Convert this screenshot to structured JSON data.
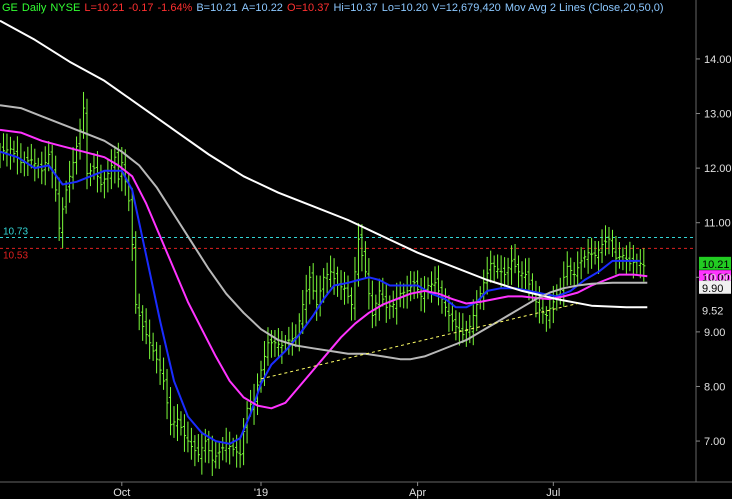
{
  "header": {
    "symbol": "GE",
    "period": "Daily",
    "exchange": "NYSE",
    "last": "L=10.21",
    "change": "-0.17",
    "change_pct": "-1.64%",
    "bid": "B=10.21",
    "ask": "A=10.22",
    "open": "O=10.37",
    "high": "Hi=10.37",
    "low": "Lo=10.20",
    "volume": "V=12,679,420",
    "study": "Mov Avg 2 Lines (Close,20,50,0)"
  },
  "colors": {
    "background": "#000000",
    "bars": "#7CFC3A",
    "ma20": "#1a2cff",
    "ma50": "#ff33ff",
    "ma200": "#ffffff",
    "ma_gray": "#b8b8b8",
    "trendline": "#ffff66",
    "level_cyan": "#33d6d6",
    "level_red": "#e02020",
    "header_green": "#33ff33",
    "header_red": "#ff3030",
    "header_blue": "#8cc8ff",
    "axis_text": "#e0e0e0"
  },
  "chart_data": {
    "type": "line",
    "title": "GE - Daily NYSE",
    "x_labels": [
      "Oct",
      "'19",
      "Apr",
      "Jul"
    ],
    "y_ticks": [
      "14.00",
      "13.00",
      "12.00",
      "11.00",
      "10.00",
      "9.00",
      "8.00",
      "7.00"
    ],
    "ylim": [
      6.25,
      14.75
    ],
    "xlim": [
      0,
      200
    ],
    "x_label_positions": [
      35,
      75,
      120,
      159
    ],
    "price_markers": [
      {
        "label": "10.21",
        "value": 10.21,
        "style": "badge-green"
      },
      {
        "label": "10.00",
        "value": 10.02,
        "style": "badge-magenta"
      },
      {
        "label": "9.90",
        "value": 9.9,
        "style": "badge-white"
      },
      {
        "label": "9.52",
        "value": 9.52,
        "style": "plain"
      }
    ],
    "levels": [
      {
        "label": "10.73",
        "value": 10.73,
        "color": "cyan"
      },
      {
        "label": "10.53",
        "value": 10.53,
        "color": "red"
      }
    ],
    "trendline": [
      [
        75,
        8.14
      ],
      [
        166,
        9.52
      ]
    ],
    "price_close": [
      [
        0,
        12.3
      ],
      [
        3,
        12.35
      ],
      [
        6,
        12.1
      ],
      [
        9,
        12.15
      ],
      [
        12,
        11.95
      ],
      [
        14,
        12.25
      ],
      [
        16,
        11.6
      ],
      [
        17,
        10.9
      ],
      [
        19,
        11.6
      ],
      [
        21,
        12.1
      ],
      [
        23,
        12.7
      ],
      [
        24,
        13.1
      ],
      [
        25,
        11.9
      ],
      [
        27,
        12.0
      ],
      [
        29,
        11.7
      ],
      [
        31,
        11.9
      ],
      [
        33,
        12.2
      ],
      [
        34,
        11.8
      ],
      [
        35,
        12.1
      ],
      [
        37,
        11.4
      ],
      [
        38,
        10.6
      ],
      [
        39,
        9.5
      ],
      [
        41,
        9.1
      ],
      [
        43,
        8.8
      ],
      [
        45,
        8.5
      ],
      [
        47,
        8.1
      ],
      [
        49,
        7.3
      ],
      [
        51,
        7.4
      ],
      [
        53,
        7.1
      ],
      [
        55,
        6.9
      ],
      [
        57,
        6.75
      ],
      [
        59,
        7.0
      ],
      [
        61,
        6.65
      ],
      [
        63,
        6.8
      ],
      [
        65,
        6.95
      ],
      [
        67,
        6.85
      ],
      [
        69,
        6.75
      ],
      [
        71,
        7.6
      ],
      [
        73,
        7.75
      ],
      [
        75,
        8.3
      ],
      [
        77,
        8.8
      ],
      [
        79,
        8.8
      ],
      [
        81,
        8.75
      ],
      [
        83,
        8.85
      ],
      [
        85,
        8.9
      ],
      [
        87,
        9.5
      ],
      [
        89,
        10.0
      ],
      [
        91,
        9.5
      ],
      [
        93,
        10.0
      ],
      [
        95,
        10.1
      ],
      [
        97,
        9.85
      ],
      [
        99,
        9.8
      ],
      [
        101,
        9.5
      ],
      [
        103,
        10.7
      ],
      [
        105,
        10.1
      ],
      [
        107,
        9.3
      ],
      [
        109,
        9.75
      ],
      [
        111,
        9.45
      ],
      [
        113,
        9.5
      ],
      [
        115,
        9.7
      ],
      [
        117,
        9.75
      ],
      [
        119,
        9.9
      ],
      [
        121,
        9.65
      ],
      [
        123,
        9.85
      ],
      [
        125,
        9.9
      ],
      [
        127,
        9.6
      ],
      [
        129,
        9.3
      ],
      [
        131,
        9.1
      ],
      [
        133,
        8.95
      ],
      [
        135,
        9.1
      ],
      [
        137,
        9.5
      ],
      [
        139,
        9.9
      ],
      [
        141,
        10.25
      ],
      [
        143,
        10.15
      ],
      [
        145,
        10.05
      ],
      [
        147,
        10.3
      ],
      [
        149,
        10.1
      ],
      [
        151,
        10.05
      ],
      [
        153,
        9.7
      ],
      [
        155,
        9.4
      ],
      [
        157,
        9.3
      ],
      [
        159,
        9.55
      ],
      [
        161,
        9.8
      ],
      [
        163,
        10.2
      ],
      [
        165,
        10.05
      ],
      [
        167,
        10.3
      ],
      [
        169,
        10.45
      ],
      [
        171,
        10.4
      ],
      [
        173,
        10.6
      ],
      [
        175,
        10.7
      ],
      [
        177,
        10.35
      ],
      [
        179,
        10.4
      ],
      [
        181,
        10.25
      ],
      [
        183,
        10.3
      ],
      [
        185,
        10.21
      ]
    ],
    "series": [
      {
        "name": "MA20",
        "points": [
          [
            0,
            12.3
          ],
          [
            5,
            12.2
          ],
          [
            10,
            12.0
          ],
          [
            14,
            12.05
          ],
          [
            18,
            11.7
          ],
          [
            22,
            11.75
          ],
          [
            26,
            11.85
          ],
          [
            30,
            11.95
          ],
          [
            35,
            11.95
          ],
          [
            38,
            11.6
          ],
          [
            42,
            10.4
          ],
          [
            46,
            9.2
          ],
          [
            50,
            8.1
          ],
          [
            54,
            7.45
          ],
          [
            58,
            7.15
          ],
          [
            62,
            7.0
          ],
          [
            66,
            6.95
          ],
          [
            69,
            7.05
          ],
          [
            72,
            7.5
          ],
          [
            75,
            8.05
          ],
          [
            78,
            8.4
          ],
          [
            82,
            8.65
          ],
          [
            86,
            8.95
          ],
          [
            90,
            9.3
          ],
          [
            93,
            9.6
          ],
          [
            96,
            9.85
          ],
          [
            100,
            9.9
          ],
          [
            103,
            9.95
          ],
          [
            106,
            10.0
          ],
          [
            109,
            9.95
          ],
          [
            112,
            9.85
          ],
          [
            115,
            9.85
          ],
          [
            118,
            9.85
          ],
          [
            120,
            9.85
          ],
          [
            124,
            9.7
          ],
          [
            128,
            9.6
          ],
          [
            131,
            9.45
          ],
          [
            134,
            9.45
          ],
          [
            137,
            9.55
          ],
          [
            140,
            9.75
          ],
          [
            144,
            9.8
          ],
          [
            148,
            9.8
          ],
          [
            152,
            9.75
          ],
          [
            156,
            9.7
          ],
          [
            160,
            9.65
          ],
          [
            164,
            9.75
          ],
          [
            168,
            9.95
          ],
          [
            172,
            10.1
          ],
          [
            176,
            10.3
          ],
          [
            180,
            10.3
          ],
          [
            184,
            10.3
          ]
        ]
      },
      {
        "name": "MA50",
        "points": [
          [
            0,
            12.7
          ],
          [
            6,
            12.65
          ],
          [
            12,
            12.5
          ],
          [
            18,
            12.4
          ],
          [
            24,
            12.3
          ],
          [
            30,
            12.2
          ],
          [
            34,
            12.05
          ],
          [
            38,
            11.85
          ],
          [
            42,
            11.35
          ],
          [
            46,
            10.75
          ],
          [
            50,
            10.15
          ],
          [
            54,
            9.55
          ],
          [
            58,
            9.05
          ],
          [
            62,
            8.55
          ],
          [
            66,
            8.1
          ],
          [
            70,
            7.8
          ],
          [
            74,
            7.65
          ],
          [
            78,
            7.6
          ],
          [
            82,
            7.7
          ],
          [
            86,
            8.0
          ],
          [
            90,
            8.3
          ],
          [
            94,
            8.6
          ],
          [
            98,
            8.9
          ],
          [
            102,
            9.15
          ],
          [
            106,
            9.35
          ],
          [
            110,
            9.5
          ],
          [
            114,
            9.6
          ],
          [
            118,
            9.7
          ],
          [
            122,
            9.75
          ],
          [
            126,
            9.7
          ],
          [
            130,
            9.6
          ],
          [
            134,
            9.52
          ],
          [
            138,
            9.55
          ],
          [
            142,
            9.6
          ],
          [
            146,
            9.65
          ],
          [
            150,
            9.65
          ],
          [
            154,
            9.62
          ],
          [
            158,
            9.6
          ],
          [
            162,
            9.65
          ],
          [
            166,
            9.72
          ],
          [
            170,
            9.85
          ],
          [
            174,
            9.95
          ],
          [
            178,
            10.05
          ],
          [
            182,
            10.05
          ],
          [
            186,
            10.02
          ]
        ]
      },
      {
        "name": "MA200",
        "points": [
          [
            0,
            14.7
          ],
          [
            10,
            14.35
          ],
          [
            20,
            13.95
          ],
          [
            30,
            13.6
          ],
          [
            40,
            13.15
          ],
          [
            50,
            12.7
          ],
          [
            60,
            12.25
          ],
          [
            70,
            11.85
          ],
          [
            80,
            11.55
          ],
          [
            90,
            11.3
          ],
          [
            100,
            11.05
          ],
          [
            110,
            10.75
          ],
          [
            120,
            10.45
          ],
          [
            130,
            10.2
          ],
          [
            140,
            9.95
          ],
          [
            150,
            9.75
          ],
          [
            160,
            9.6
          ],
          [
            170,
            9.48
          ],
          [
            180,
            9.45
          ],
          [
            186,
            9.45
          ]
        ]
      },
      {
        "name": "MA100",
        "points": [
          [
            0,
            13.15
          ],
          [
            6,
            13.1
          ],
          [
            12,
            12.95
          ],
          [
            18,
            12.8
          ],
          [
            24,
            12.65
          ],
          [
            30,
            12.5
          ],
          [
            35,
            12.3
          ],
          [
            40,
            12.05
          ],
          [
            45,
            11.65
          ],
          [
            50,
            11.15
          ],
          [
            55,
            10.65
          ],
          [
            60,
            10.15
          ],
          [
            65,
            9.7
          ],
          [
            70,
            9.35
          ],
          [
            75,
            9.05
          ],
          [
            80,
            8.85
          ],
          [
            85,
            8.75
          ],
          [
            90,
            8.7
          ],
          [
            95,
            8.65
          ],
          [
            100,
            8.6
          ],
          [
            105,
            8.6
          ],
          [
            110,
            8.55
          ],
          [
            115,
            8.5
          ],
          [
            118,
            8.5
          ],
          [
            122,
            8.55
          ],
          [
            126,
            8.65
          ],
          [
            130,
            8.75
          ],
          [
            134,
            8.85
          ],
          [
            138,
            9.0
          ],
          [
            142,
            9.15
          ],
          [
            146,
            9.3
          ],
          [
            150,
            9.45
          ],
          [
            154,
            9.6
          ],
          [
            158,
            9.72
          ],
          [
            162,
            9.8
          ],
          [
            166,
            9.85
          ],
          [
            170,
            9.88
          ],
          [
            176,
            9.9
          ],
          [
            186,
            9.9
          ]
        ]
      }
    ],
    "grid": false,
    "legend": "none"
  }
}
